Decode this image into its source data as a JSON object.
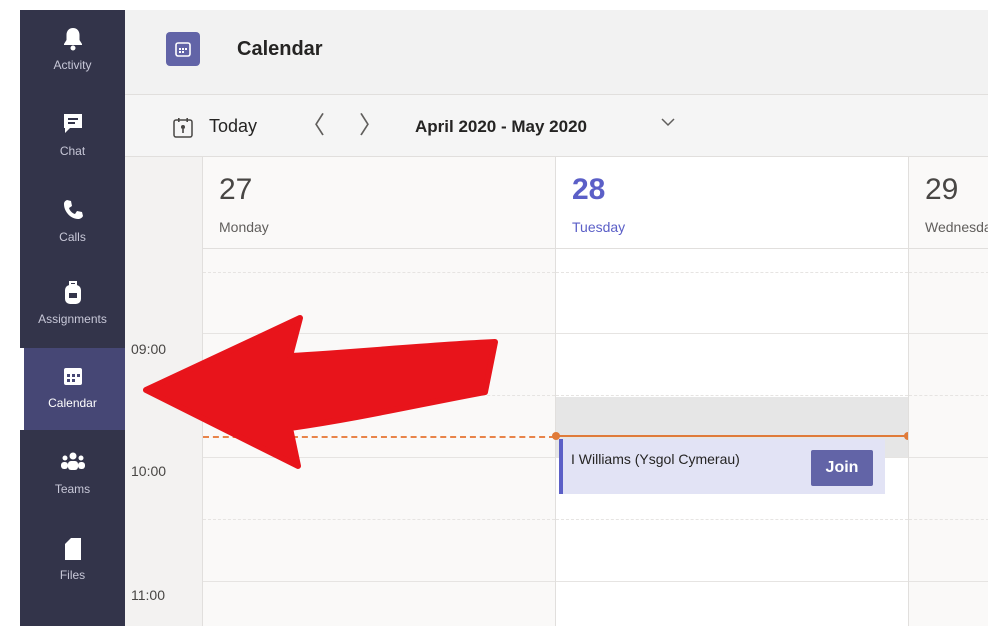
{
  "rail": {
    "items": [
      {
        "label": "Activity",
        "icon": "bell-icon"
      },
      {
        "label": "Chat",
        "icon": "chat-icon"
      },
      {
        "label": "Calls",
        "icon": "phone-icon"
      },
      {
        "label": "Assignments",
        "icon": "backpack-icon"
      },
      {
        "label": "Calendar",
        "icon": "calendar-icon",
        "active": true
      },
      {
        "label": "Teams",
        "icon": "teams-icon"
      },
      {
        "label": "Files",
        "icon": "file-icon"
      }
    ]
  },
  "header": {
    "title": "Calendar"
  },
  "toolbar": {
    "today_label": "Today",
    "prev_label": "〈",
    "next_label": "〉",
    "range_label": "April 2020 - May 2020"
  },
  "grid": {
    "times": [
      "09:00",
      "10:00",
      "11:00"
    ],
    "days": [
      {
        "num": "27",
        "name": "Monday"
      },
      {
        "num": "28",
        "name": "Tuesday",
        "today": true
      },
      {
        "num": "29",
        "name": "Wednesday"
      }
    ],
    "event": {
      "title": "I Williams (Ysgol Cymerau)",
      "join_label": "Join"
    }
  },
  "colors": {
    "rail_bg": "#33344a",
    "rail_active": "#464775",
    "brand": "#6264a7",
    "today_accent": "#5b5fc7",
    "now_line": "#e07b39",
    "annotation_arrow": "#e8141b"
  }
}
